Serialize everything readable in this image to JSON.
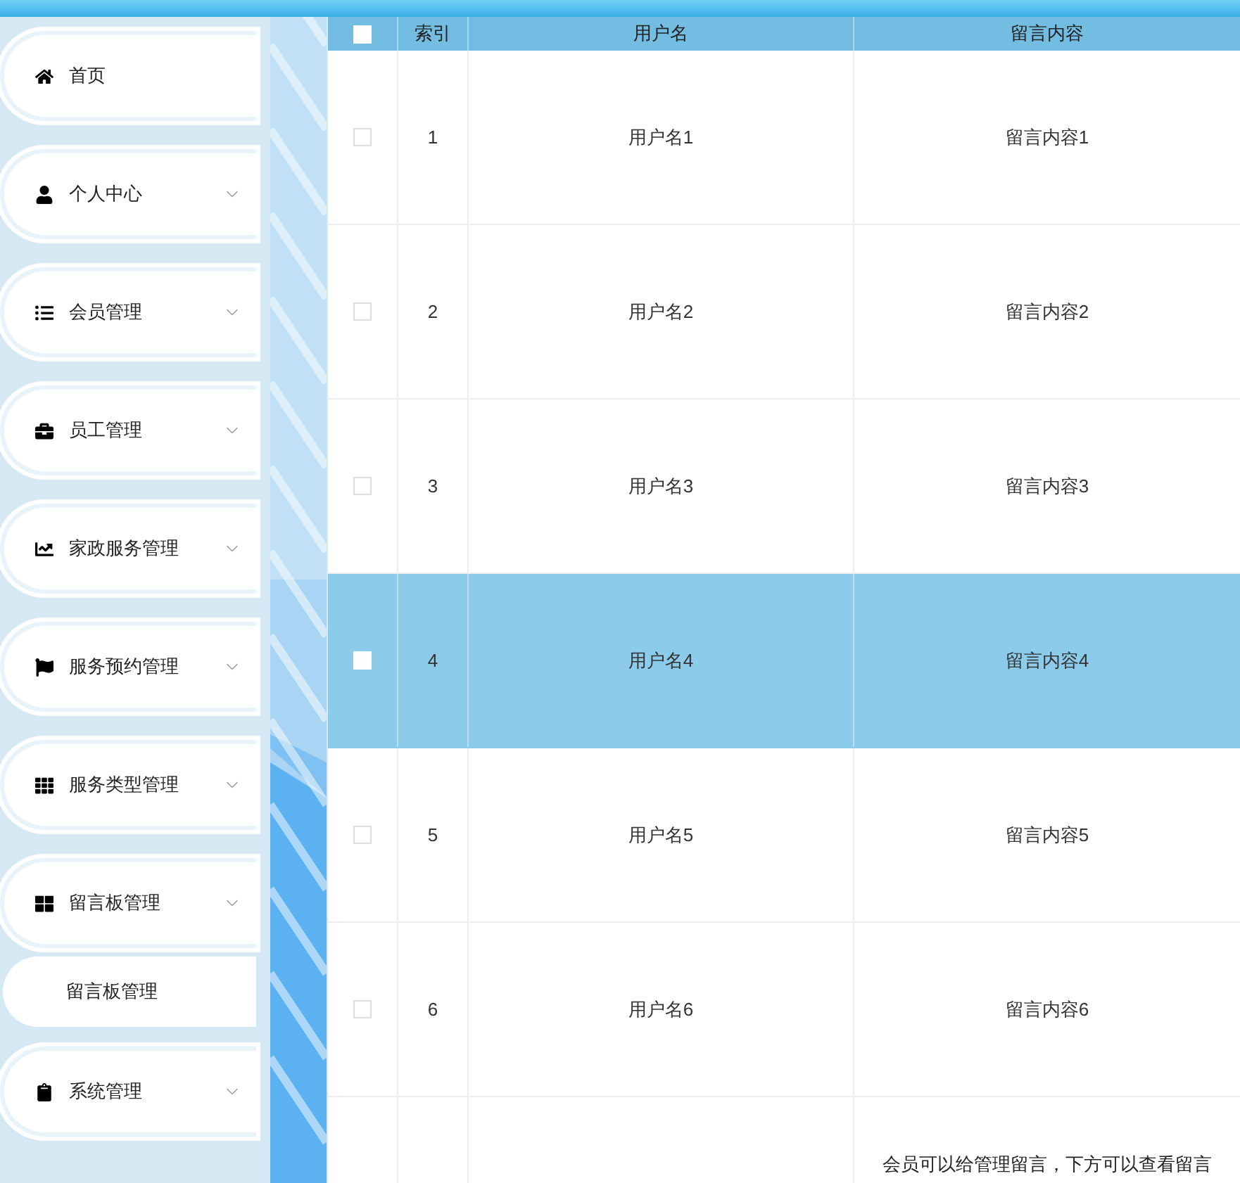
{
  "sidebar": {
    "items": [
      {
        "label": "首页",
        "expandable": false
      },
      {
        "label": "个人中心",
        "expandable": true
      },
      {
        "label": "会员管理",
        "expandable": true
      },
      {
        "label": "员工管理",
        "expandable": true
      },
      {
        "label": "家政服务管理",
        "expandable": true
      },
      {
        "label": "服务预约管理",
        "expandable": true
      },
      {
        "label": "服务类型管理",
        "expandable": true
      },
      {
        "label": "留言板管理",
        "expandable": true,
        "children": [
          {
            "label": "留言板管理"
          }
        ]
      },
      {
        "label": "系统管理",
        "expandable": true
      }
    ]
  },
  "table": {
    "select_all_checked": false,
    "columns": [
      "索引",
      "用户名",
      "留言内容"
    ],
    "rows": [
      {
        "index": "1",
        "username": "用户名1",
        "content": "留言内容1",
        "selected": false
      },
      {
        "index": "2",
        "username": "用户名2",
        "content": "留言内容2",
        "selected": false
      },
      {
        "index": "3",
        "username": "用户名3",
        "content": "留言内容3",
        "selected": false
      },
      {
        "index": "4",
        "username": "用户名4",
        "content": "留言内容4",
        "selected": true
      },
      {
        "index": "5",
        "username": "用户名5",
        "content": "留言内容5",
        "selected": false
      },
      {
        "index": "6",
        "username": "用户名6",
        "content": "留言内容6",
        "selected": false
      }
    ],
    "note": "会员可以给管理留言，下方可以查看留言"
  }
}
